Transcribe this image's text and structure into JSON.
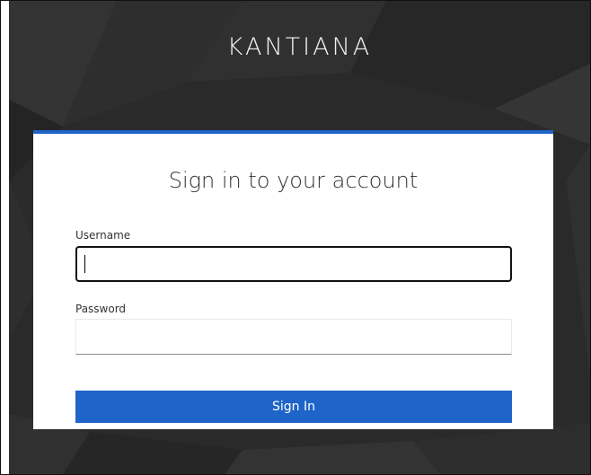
{
  "brand": {
    "name": "KANTIANA"
  },
  "login": {
    "title": "Sign in to your account",
    "username": {
      "label": "Username",
      "value": ""
    },
    "password": {
      "label": "Password",
      "value": ""
    },
    "submit_label": "Sign In"
  },
  "colors": {
    "accent": "#1f64c8",
    "background": "#2a2a2a",
    "card": "#ffffff"
  }
}
